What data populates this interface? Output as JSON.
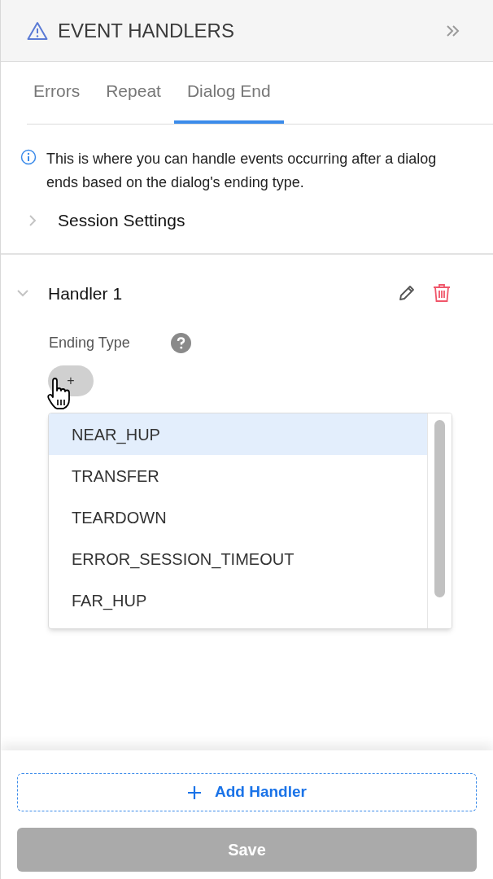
{
  "panel": {
    "title": "EVENT HANDLERS"
  },
  "tabs": [
    {
      "label": "Errors",
      "selected": false
    },
    {
      "label": "Repeat",
      "selected": false
    },
    {
      "label": "Dialog End",
      "selected": true
    }
  ],
  "info": "This is where you can handle events occurring after a dialog ends based on the dialog's ending type.",
  "session_settings": {
    "label": "Session Settings",
    "expanded": false
  },
  "handler": {
    "title": "Handler 1",
    "expanded": true,
    "field_label": "Ending Type",
    "add_chip": "+",
    "options": [
      {
        "label": "NEAR_HUP",
        "selected": true
      },
      {
        "label": "TRANSFER",
        "selected": false
      },
      {
        "label": "TEARDOWN",
        "selected": false
      },
      {
        "label": "ERROR_SESSION_TIMEOUT",
        "selected": false
      },
      {
        "label": "FAR_HUP",
        "selected": false
      }
    ]
  },
  "footer": {
    "add_button": "Add Handler",
    "save_button": "Save",
    "save_disabled": true
  }
}
